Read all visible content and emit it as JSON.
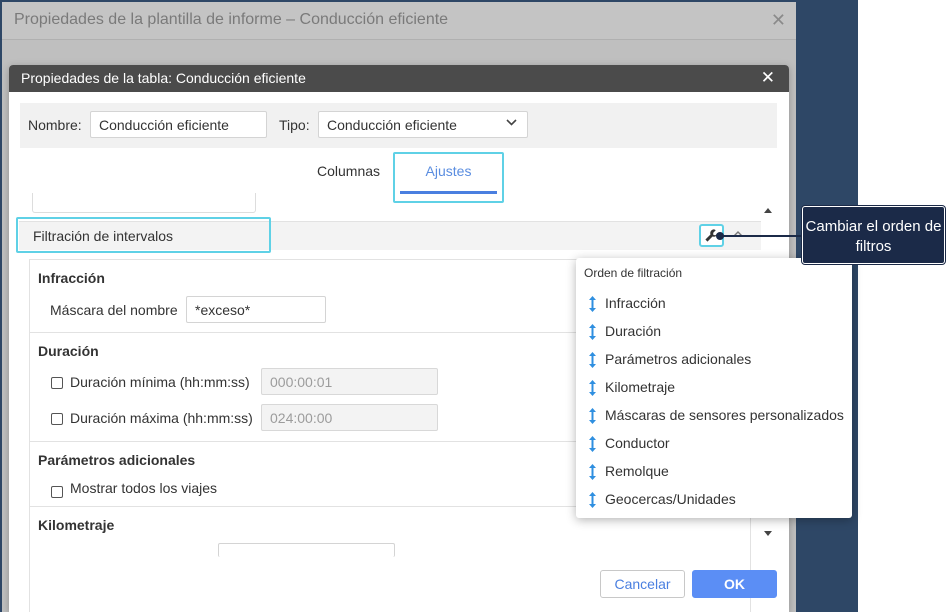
{
  "outer_window": {
    "title": "Propiedades de la plantilla de informe – Conducción eficiente",
    "close": "✕"
  },
  "dialog": {
    "title": "Propiedades de la tabla: Conducción eficiente",
    "close": "✕",
    "name_label": "Nombre:",
    "name_value": "Conducción eficiente",
    "type_label": "Tipo:",
    "type_value": "Conducción eficiente",
    "tabs": [
      {
        "label": "Columnas",
        "active": false
      },
      {
        "label": "Ajustes",
        "active": true
      }
    ]
  },
  "filter_header": {
    "label": "Filtración de intervalos"
  },
  "sections": {
    "infraccion": {
      "title": "Infracción",
      "mask_label": "Máscara del nombre",
      "mask_value": "*exceso*"
    },
    "duracion": {
      "title": "Duración",
      "min_label": "Duración mínima (hh:mm:ss)",
      "min_value": "000:00:01",
      "max_label": "Duración máxima (hh:mm:ss)",
      "max_value": "024:00:00"
    },
    "parametros": {
      "title": "Parámetros adicionales",
      "show_all_label": "Mostrar todos los viajes"
    },
    "kilometraje": {
      "title": "Kilometraje"
    }
  },
  "popup": {
    "title": "Orden de filtración",
    "items": [
      "Infracción",
      "Duración",
      "Parámetros adicionales",
      "Kilometraje",
      "Máscaras de sensores personalizados",
      "Conductor",
      "Remolque",
      "Geocercas/Unidades"
    ]
  },
  "callout": {
    "text": "Cambiar el orden de filtros"
  },
  "footer": {
    "cancel": "Cancelar",
    "ok": "OK"
  },
  "colors": {
    "accent": "#5b8ef5",
    "highlight": "#5fd1e6",
    "callout_bg": "#1b2a48",
    "reorder_icon": "#2f8fe0"
  },
  "icons": {
    "settings": "wrench-icon",
    "reorder": "drag-arrows-icon"
  }
}
